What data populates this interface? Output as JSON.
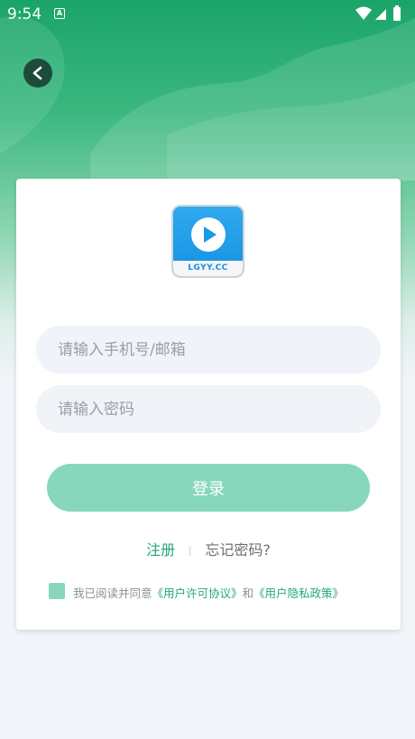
{
  "status_bar": {
    "time": "9:54",
    "a_icon": "A"
  },
  "nav": {
    "back_icon": "chevron-left-icon"
  },
  "logo": {
    "text": "LGYY.CC"
  },
  "form": {
    "account_placeholder": "请输入手机号/邮箱",
    "password_placeholder": "请输入密码",
    "login_label": "登录"
  },
  "links": {
    "register": "注册",
    "forgot": "忘记密码?"
  },
  "agreement": {
    "prefix": "我已阅读并同意",
    "user_agreement": "《用户许可协议》",
    "and": "和",
    "privacy_policy": "《用户隐私政策》"
  },
  "colors": {
    "primary": "#22a776",
    "button": "#87d7bc",
    "input_bg": "#f0f3f8",
    "page_bg": "#f1f4f9"
  }
}
